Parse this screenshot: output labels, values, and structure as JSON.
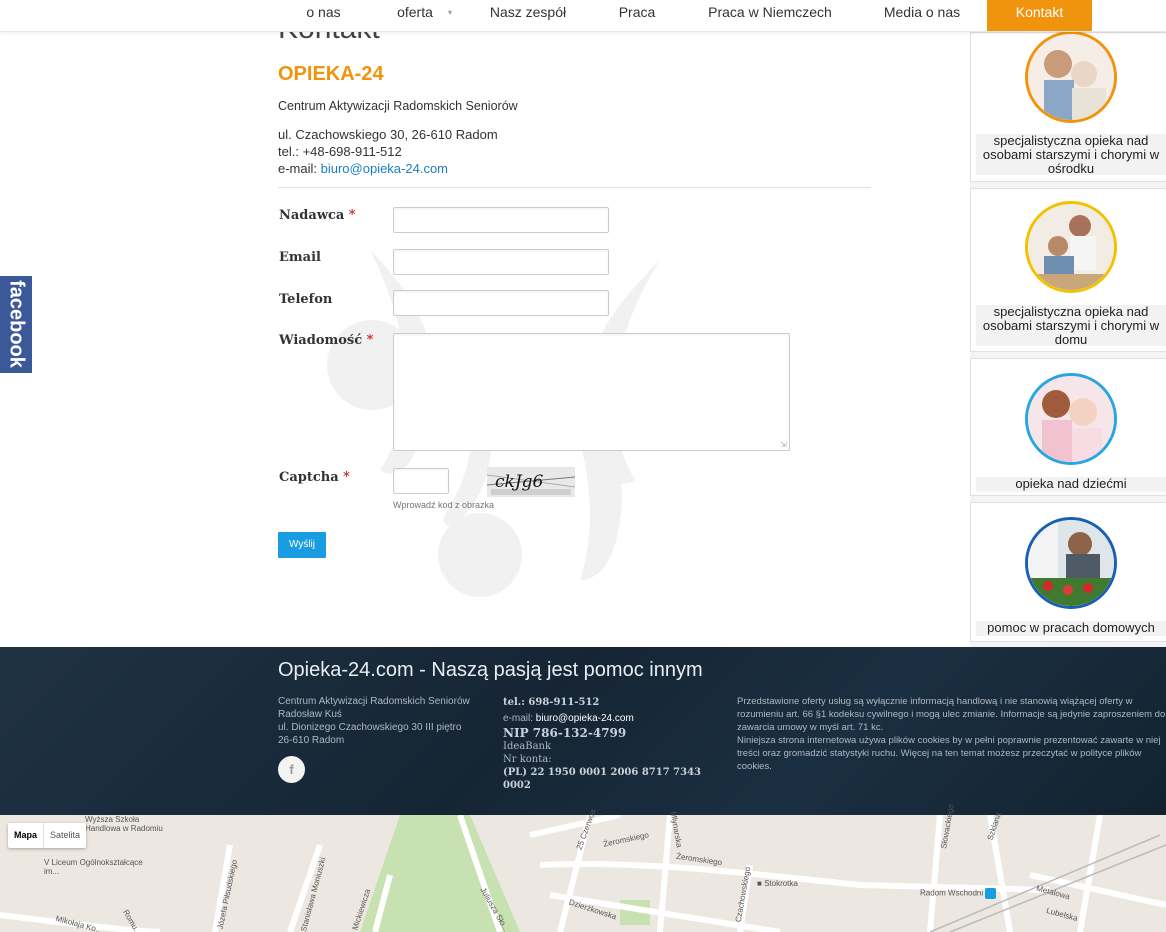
{
  "nav": {
    "items": [
      "o nas",
      "oferta",
      "Nasz zespół",
      "Praca",
      "Praca w Niemczech",
      "Media o nas",
      "Kontakt"
    ],
    "active": "Kontakt"
  },
  "page": {
    "heading": "Kontakt",
    "brand": "OPIEKA-24",
    "org": "Centrum Aktywizacji Radomskich Seniorów",
    "address": "ul. Czachowskiego 30, 26-610 Radom",
    "tel": "tel.: +48-698-911-512",
    "email_label": "e-mail: ",
    "email": "biuro@opieka-24.com"
  },
  "form": {
    "sender_label": "Nadawca",
    "email_label": "Email",
    "phone_label": "Telefon",
    "message_label": "Wiadomość",
    "captcha_label": "Captcha",
    "required_mark": "*",
    "captcha_hint": "Wprowadź kod z obrazka",
    "captcha_text": "ckJg6",
    "submit": "Wyślij"
  },
  "facebook_tab": "facebook",
  "sidebar": {
    "cards": [
      {
        "text": "specjalistyczna opieka nad osobami starszymi i chorymi w ośrodku",
        "ring_color": "#f0940e"
      },
      {
        "text": "specjalistyczna opieka nad osobami starszymi i chorymi w domu",
        "ring_color": "#f2c200"
      },
      {
        "text": "opieka nad dziećmi",
        "ring_color": "#27a6e0"
      },
      {
        "text": "pomoc w pracach domowych",
        "ring_color": "#1a5fb4"
      }
    ]
  },
  "footer": {
    "title": "Opieka-24.com - Naszą pasją jest pomoc innym",
    "col1": [
      "Centrum Aktywizacji Radomskich Seniorów",
      "Radosław Kuś",
      "ul. Dionizego Czachowskiego 30 III piętro",
      "26-610 Radom"
    ],
    "phone": "tel.: 698-911-512",
    "email_label": "e-mail: ",
    "email": "biuro@opieka-24.com",
    "nip": "NIP 786-132-4799",
    "bank": "IdeaBank",
    "account_label": "Nr konta:",
    "account": "(PL) 22 1950 0001 2006 8717 7343 0002",
    "disclaimer1": "Przedstawione oferty usług są wyłącznie informacją handlową i nie stanowią wiążącej oferty w rozumieniu art. 66 §1 kodeksu cywilnego i mogą ulec zmianie. Informacje są jedynie zaproszeniem do zawarcia umowy w myśl art. 71 kc.",
    "disclaimer2": "Niniejsza strona internetowa używa plików cookies by w pełni poprawnie prezentować zawarte w niej treści oraz gromadzić statystyki ruchu. Więcej na ten temat możesz przeczytać w polityce plików cookies.",
    "fb_icon": "f"
  },
  "map": {
    "toggle": [
      "Mapa",
      "Satelita"
    ],
    "labels": [
      "Wyższa Szkoła Handlowa w Radomiu",
      "V Liceum Ogólnokształcące im...",
      "Mikołaja Ko...",
      "Romu...",
      "Józefa Piłsudskiego",
      "Stanisława Moniuszki",
      "Mickiewicza",
      "Juliusza Sło...",
      "Dzierżkowska",
      "25 Czerwca",
      "Żeromskiego",
      "Żeromskiego",
      "Mlynarska",
      "Czachowskiego",
      "Stokrotka",
      "Radom Wschodni",
      "Metalowa",
      "Lubelska",
      "Szklana",
      "Słowackiego"
    ]
  }
}
